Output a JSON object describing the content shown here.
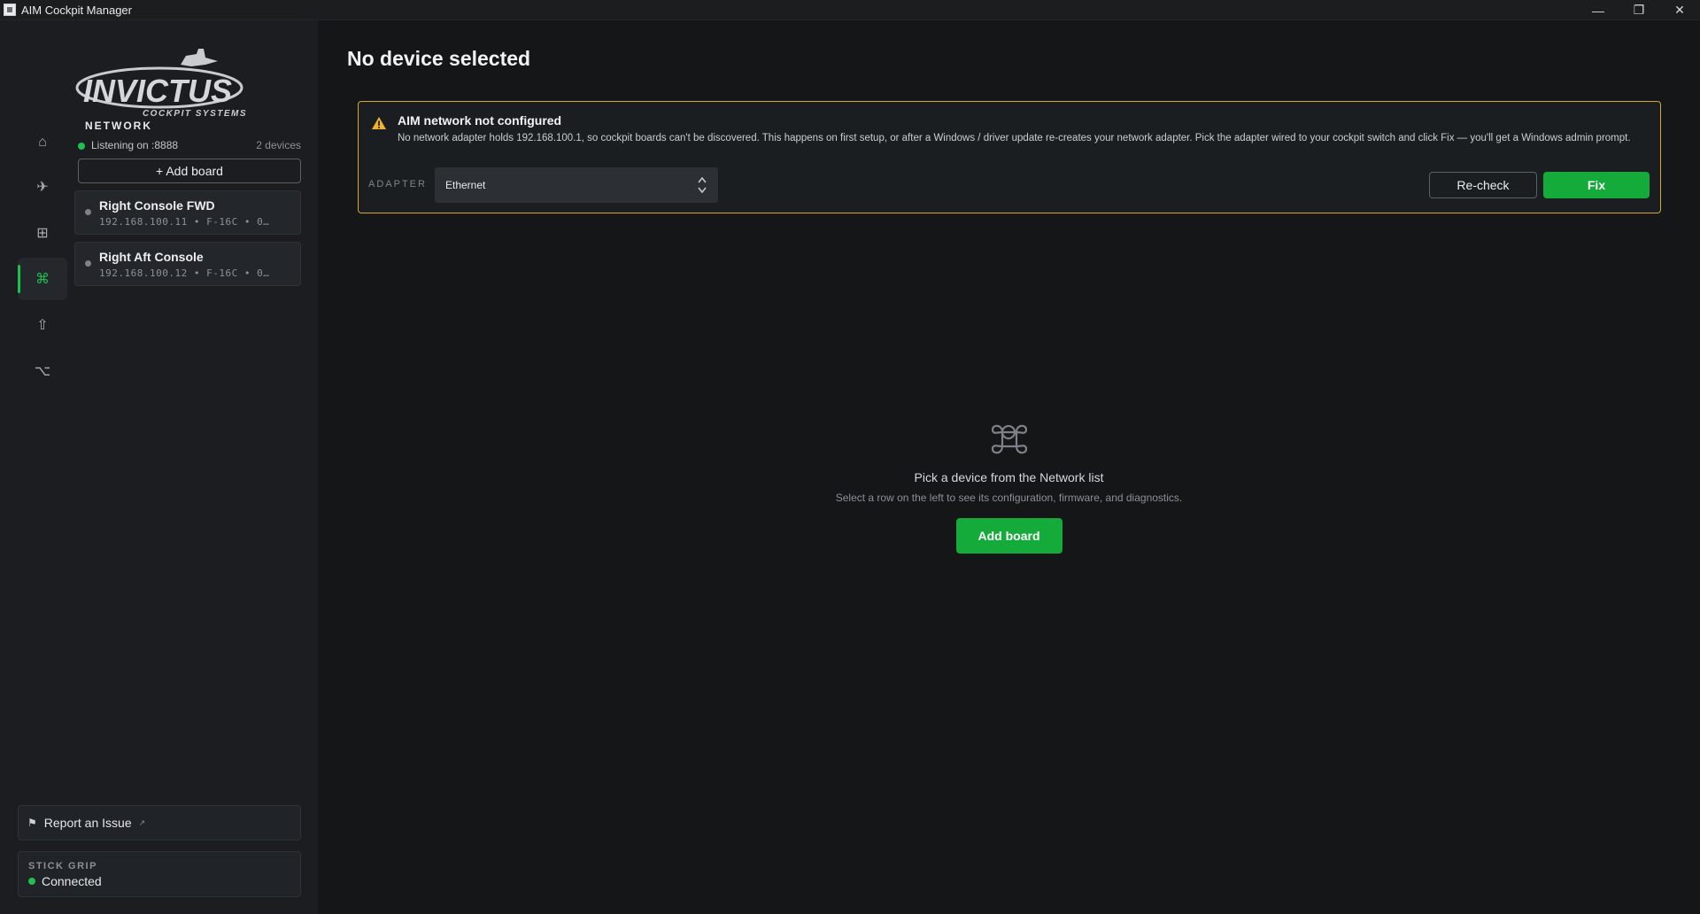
{
  "window": {
    "title": "AIM Cockpit Manager",
    "minimize_glyph": "—",
    "restore_glyph": "❐",
    "close_glyph": "✕"
  },
  "logo": {
    "brand": "INVICTUS",
    "tagline": "COCKPIT SYSTEMS"
  },
  "nav": [
    {
      "icon": "home-icon",
      "glyph": "⌂"
    },
    {
      "icon": "airplane-icon",
      "glyph": "✈"
    },
    {
      "icon": "grid-icon",
      "glyph": "⊞"
    },
    {
      "icon": "network-command-icon",
      "glyph": "⌘"
    },
    {
      "icon": "upload-icon",
      "glyph": "⇧"
    },
    {
      "icon": "option-switch-icon",
      "glyph": "⌥"
    }
  ],
  "network": {
    "title": "NETWORK",
    "listening": "Listening on :8888",
    "device_count": "2 devices",
    "add_board_label": "+ Add board",
    "devices": [
      {
        "name": "Right Console FWD",
        "sub": "192.168.100.11  •  F-16C  •  0…"
      },
      {
        "name": "Right Aft Console",
        "sub": "192.168.100.12  •  F-16C  •  0…"
      }
    ]
  },
  "report": {
    "label": "Report an Issue",
    "ext_glyph": "↗"
  },
  "stick": {
    "label": "STICK GRIP",
    "status": "Connected"
  },
  "main": {
    "title": "No device selected",
    "alert": {
      "title": "AIM network not configured",
      "body": "No network adapter holds 192.168.100.1, so cockpit boards can't be discovered. This happens on first setup, or after a Windows / driver update re-creates your network adapter. Pick the adapter wired to your cockpit switch and click Fix — you'll get a Windows admin prompt.",
      "adapter_label": "ADAPTER",
      "adapter_value": "Ethernet",
      "recheck_label": "Re-check",
      "fix_label": "Fix"
    },
    "empty": {
      "title": "Pick a device from the Network list",
      "subtitle": "Select a row on the left to see its configuration, firmware, and diagnostics.",
      "button_label": "Add board"
    }
  },
  "colors": {
    "accent": "#14ab3a",
    "warning": "#d6a62f",
    "background": "#141618",
    "sidebar": "#1b1d20"
  }
}
